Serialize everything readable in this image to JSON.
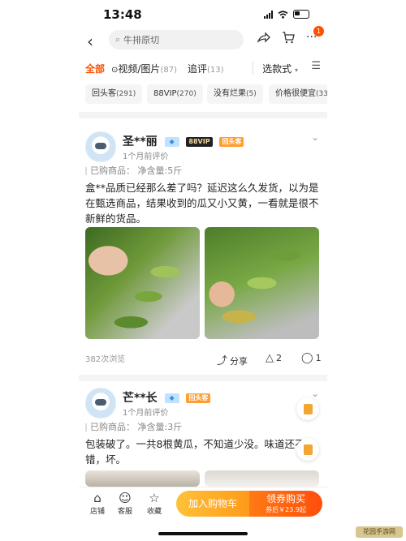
{
  "status": {
    "time": "13:48"
  },
  "header": {
    "search_placeholder": "牛排原切",
    "cart_badge": "1"
  },
  "tabs": [
    {
      "label": "全部",
      "count": ""
    },
    {
      "label": "视频/图片",
      "count": "(87)"
    },
    {
      "label": "追评",
      "count": "(13)"
    }
  ],
  "sort_label": "选款式",
  "chips": [
    {
      "label": "回头客",
      "count": "(291)"
    },
    {
      "label": "88VIP",
      "count": "(270)"
    },
    {
      "label": "没有烂果",
      "count": "(5)"
    },
    {
      "label": "价格很便宜",
      "count": "(33"
    }
  ],
  "reviews": [
    {
      "username": "圣**丽",
      "vip_tag": "88VIP",
      "return_tag": "回头客",
      "time_ago": "1个月前评价",
      "purchased": "已购商品：  净含量:5斤",
      "content": "盒**品质已经那么差了吗？延迟这么久发货，以为是在甄选商品，结果收到的瓜又小又黄，一看就是很不新鲜的货品。",
      "views": "382次浏览",
      "share": "分享",
      "likes": "2",
      "comments": "1"
    },
    {
      "username": "芒**长",
      "return_tag": "回头客",
      "time_ago": "1个月前评价",
      "purchased": "已购商品：  净含量:3斤",
      "content": "包装破了。一共8根黄瓜，不知道少没。味道还不错，坏。"
    }
  ],
  "bottom": {
    "store": "店铺",
    "service": "客服",
    "favorite": "收藏",
    "add_cart": "加入购物车",
    "buy": "领券购买",
    "price_note": "券后￥23.9起"
  },
  "watermark": "花园手游网"
}
